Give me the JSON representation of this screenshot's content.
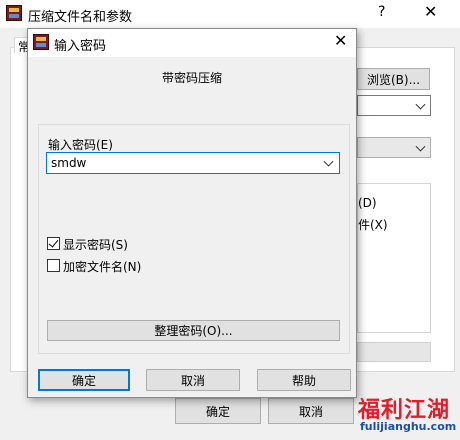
{
  "bg_window": {
    "title": "压缩文件名和参数",
    "help_glyph": "?",
    "close_glyph": "✕",
    "tab_label": "常",
    "browse_label": "浏览(B)...",
    "option_d": "(D)",
    "option_x": "件(X)",
    "ok_label": "确定",
    "cancel_label": "取消"
  },
  "pwd_dialog": {
    "title": "输入密码",
    "close_glyph": "✕",
    "subtitle": "带密码压缩",
    "password_label": "输入密码(E)",
    "password_value": "smdw",
    "show_password_label": "显示密码(S)",
    "show_password_checked": true,
    "encrypt_filenames_label": "加密文件名(N)",
    "encrypt_filenames_checked": false,
    "organize_label": "整理密码(O)...",
    "ok_label": "确定",
    "cancel_label": "取消",
    "help_label": "帮助"
  },
  "watermark": {
    "text": "福利江湖",
    "url": "fulijianghu.com",
    "colors": {
      "text": "#e11d2a",
      "url": "#1f4fa0"
    }
  },
  "colors": {
    "accent": "#0078d7",
    "dialog_bg": "#f0f0f0",
    "button_bg": "#e1e1e1"
  }
}
